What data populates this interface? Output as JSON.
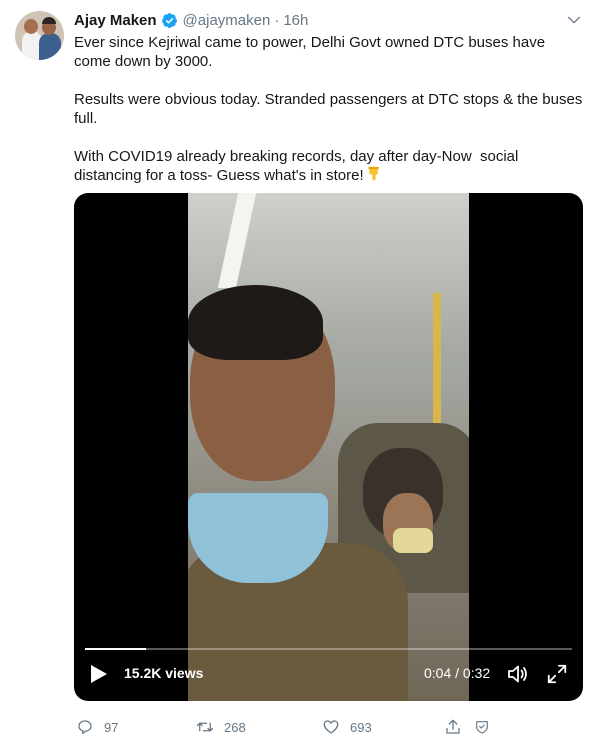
{
  "author": {
    "name": "Ajay Maken",
    "handle": "@ajaymaken",
    "separator": "·",
    "time": "16h",
    "verified_color": "#1da1f2"
  },
  "tweet": {
    "paragraphs": [
      "Ever since Kejriwal came to power, Delhi Govt owned DTC buses have come down by 3000.",
      "Results were obvious today. Stranded passengers at DTC stops & the buses full.",
      "With COVID19 already breaking records, day after day-Now  social distancing for a toss- Guess what's in store!"
    ],
    "emoji": "backhand-index-pointing-down"
  },
  "video": {
    "views": "15.2K views",
    "time_current": "0:04",
    "time_separator": " / ",
    "time_total": "0:32",
    "progress": 0.125,
    "icons": [
      "play-icon",
      "volume-icon",
      "fullscreen-icon"
    ]
  },
  "actions": {
    "replies": "97",
    "retweets": "268",
    "likes": "693",
    "icons": [
      "reply-icon",
      "retweet-icon",
      "like-icon",
      "share-icon"
    ]
  },
  "colors": {
    "text": "#14171a",
    "secondary": "#657786",
    "accent": "#1da1f2"
  }
}
